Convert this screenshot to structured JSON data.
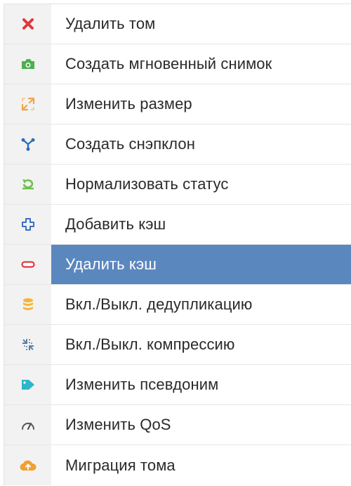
{
  "context_menu": {
    "items": [
      {
        "label": "Удалить том",
        "icon": "close-icon",
        "icon_color": "#e0393e",
        "selected": false
      },
      {
        "label": "Создать мгновенный снимок",
        "icon": "camera-icon",
        "icon_color": "#4caf50",
        "selected": false
      },
      {
        "label": "Изменить размер",
        "icon": "resize-icon",
        "icon_color": "#f0a44a",
        "selected": false
      },
      {
        "label": "Создать снэпклон",
        "icon": "fork-icon",
        "icon_color": "#2d6eb8",
        "selected": false
      },
      {
        "label": "Нормализовать статус",
        "icon": "refresh-icon",
        "icon_color": "#6cc04a",
        "selected": false
      },
      {
        "label": "Добавить кэш",
        "icon": "plus-icon",
        "icon_color": "#3a6fc0",
        "selected": false
      },
      {
        "label": "Удалить кэш",
        "icon": "minus-icon",
        "icon_color": "#e0393e",
        "selected": true
      },
      {
        "label": "Вкл./Выкл. дедупликацию",
        "icon": "database-icon",
        "icon_color": "#f4b638",
        "selected": false
      },
      {
        "label": "Вкл./Выкл. компрессию",
        "icon": "compress-icon",
        "icon_color": "#5b7fa6",
        "selected": false
      },
      {
        "label": "Изменить псевдоним",
        "icon": "tag-icon",
        "icon_color": "#2fb6c9",
        "selected": false
      },
      {
        "label": "Изменить QoS",
        "icon": "gauge-icon",
        "icon_color": "#555555",
        "selected": false
      },
      {
        "label": "Миграция тома",
        "icon": "cloud-upload-icon",
        "icon_color": "#f0a030",
        "selected": false
      }
    ]
  }
}
